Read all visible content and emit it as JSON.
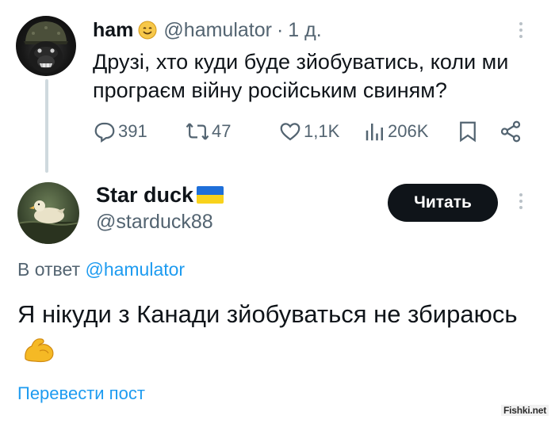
{
  "tweet1": {
    "display_name": "ham",
    "name_emoji": "smiling-face-icon",
    "handle": "@hamulator",
    "separator": "·",
    "timestamp": "1 д.",
    "text": "Друзі, хто куди буде зйобуватись, коли ми програєм війну російським свиням?",
    "actions": {
      "replies": "391",
      "reposts": "47",
      "likes": "1,1K",
      "views": "206K"
    }
  },
  "tweet2": {
    "display_name": "Star duck",
    "name_emoji": "ukraine-flag-icon",
    "handle": "@starduck88",
    "follow_label": "Читать",
    "reply_prefix": "В ответ",
    "reply_mention": "@hamulator",
    "text": "Я нікуди з Канади зйобуваться не збираюсь",
    "text_emoji": "flexed-biceps-icon",
    "translate_label": "Перевести пост"
  },
  "watermark": "Fishki.net",
  "colors": {
    "text": "#0f1419",
    "secondary": "#536471",
    "accent": "#1d9bf0",
    "button_bg": "#0f1419",
    "flag_blue": "#1e6fd9",
    "flag_yellow": "#f8d21c"
  }
}
